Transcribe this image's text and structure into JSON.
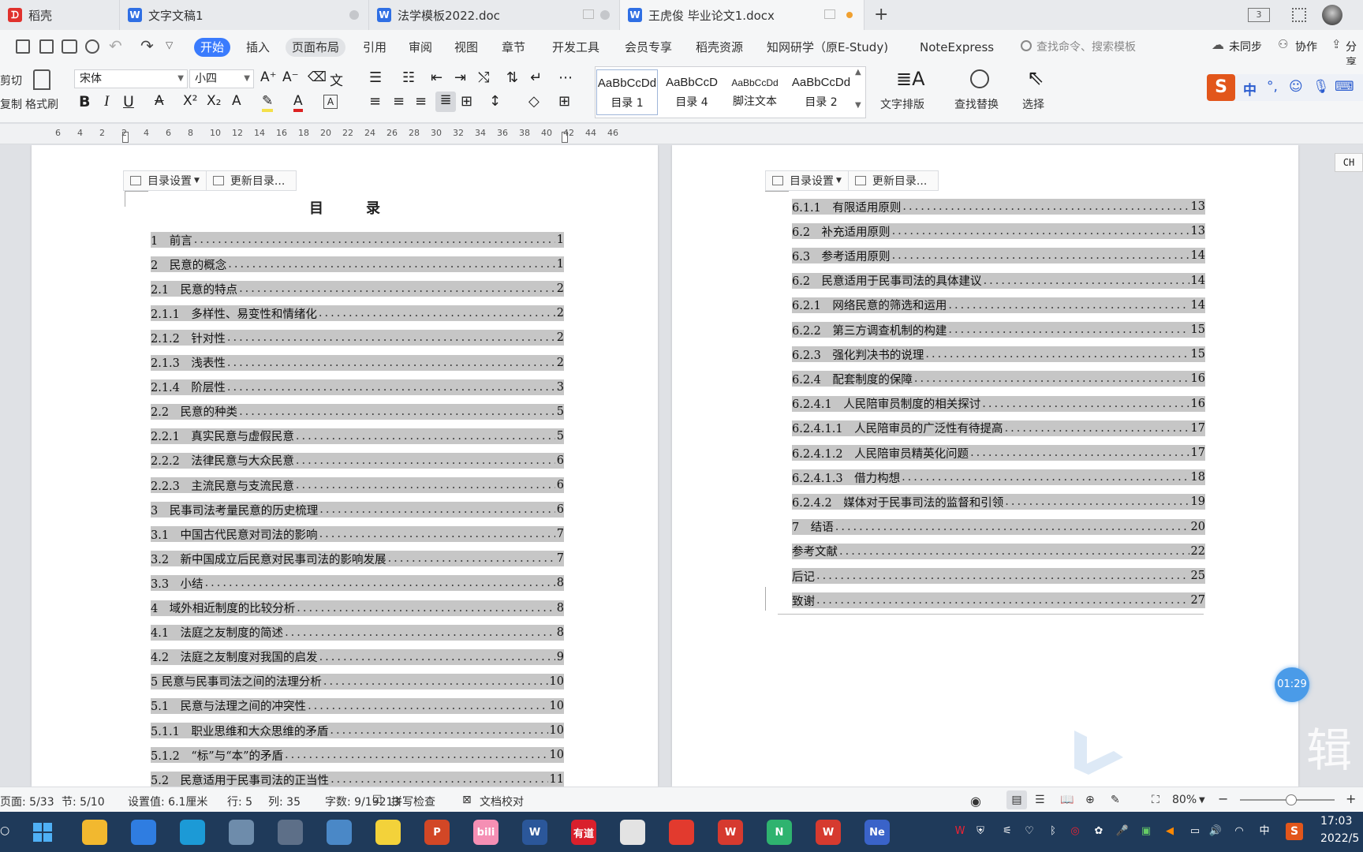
{
  "tabs": [
    {
      "label": "稻壳"
    },
    {
      "label": "文字文稿1"
    },
    {
      "label": "法学模板2022.doc"
    },
    {
      "label": "王虎俊 毕业论文1.docx"
    }
  ],
  "menu": {
    "items": [
      "开始",
      "插入",
      "页面布局",
      "引用",
      "审阅",
      "视图",
      "章节",
      "开发工具",
      "会员专享",
      "稻壳资源",
      "知网研学（原E-Study)",
      "NoteExpress"
    ],
    "search_placeholder": "查找命令、搜索模板",
    "unsynced": "未同步",
    "collab": "协作",
    "share": "分享"
  },
  "ribbon": {
    "cut": "剪切",
    "copy": "复制",
    "format_painter": "格式刷",
    "font": "宋体",
    "size": "小四",
    "styles": [
      {
        "preview": "AaBbCcDd",
        "name": "目录 1"
      },
      {
        "preview": "AaBbCcD",
        "name": "目录 4"
      },
      {
        "preview": "AaBbCcDd",
        "name": "脚注文本"
      },
      {
        "preview": "AaBbCcDd",
        "name": "目录 2"
      }
    ],
    "text_layout": "文字排版",
    "find_replace": "查找替换",
    "select": "选择",
    "ime_label": "中"
  },
  "ruler": {
    "ticks": [
      "6",
      "4",
      "2",
      "2",
      "4",
      "6",
      "8",
      "10",
      "12",
      "14",
      "16",
      "18",
      "20",
      "22",
      "24",
      "26",
      "28",
      "30",
      "32",
      "34",
      "36",
      "38",
      "40",
      "42",
      "44",
      "46"
    ]
  },
  "toc_toolbar": {
    "settings": "目录设置",
    "update": "更新目录..."
  },
  "page1": {
    "title": "目　　　录",
    "entries": [
      {
        "text": "1　前言",
        "page": "1"
      },
      {
        "text": "2　民意的概念",
        "page": "1"
      },
      {
        "text": "2.1　民意的特点",
        "page": "2"
      },
      {
        "text": "2.1.1　多样性、易变性和情绪化",
        "page": "2"
      },
      {
        "text": "2.1.2　针对性",
        "page": "2"
      },
      {
        "text": "2.1.3　浅表性",
        "page": "2"
      },
      {
        "text": "2.1.4　阶层性",
        "page": "3"
      },
      {
        "text": "2.2　民意的种类",
        "page": "5"
      },
      {
        "text": "2.2.1　真实民意与虚假民意",
        "page": "5"
      },
      {
        "text": "2.2.2　法律民意与大众民意",
        "page": "6"
      },
      {
        "text": "2.2.3　主流民意与支流民意",
        "page": "6"
      },
      {
        "text": "3　民事司法考量民意的历史梳理",
        "page": "6"
      },
      {
        "text": "3.1　中国古代民意对司法的影响",
        "page": "7"
      },
      {
        "text": "3.2　新中国成立后民意对民事司法的影响发展",
        "page": "7"
      },
      {
        "text": "3.3　小结",
        "page": "8"
      },
      {
        "text": "4　域外相近制度的比较分析",
        "page": "8"
      },
      {
        "text": "4.1　法庭之友制度的简述",
        "page": "8"
      },
      {
        "text": "4.2　法庭之友制度对我国的启发",
        "page": "9"
      },
      {
        "text": "5 民意与民事司法之间的法理分析",
        "page": "10"
      },
      {
        "text": "5.1　民意与法理之间的冲突性",
        "page": "10"
      },
      {
        "text": "5.1.1　职业思维和大众思维的矛盾",
        "page": "10"
      },
      {
        "text": "5.1.2　“标”与“本”的矛盾",
        "page": "10"
      },
      {
        "text": "5.2　民意适用于民事司法的正当性",
        "page": "11"
      }
    ]
  },
  "page2": {
    "entries": [
      {
        "text": "6.1.1　有限适用原则",
        "page": "13"
      },
      {
        "text": "6.2　补充适用原则",
        "page": "13"
      },
      {
        "text": "6.3　参考适用原则",
        "page": "14"
      },
      {
        "text": "6.2　民意适用于民事司法的具体建议",
        "page": "14"
      },
      {
        "text": "6.2.1　网络民意的筛选和运用",
        "page": "14"
      },
      {
        "text": "6.2.2　第三方调查机制的构建",
        "page": "15"
      },
      {
        "text": "6.2.3　强化判决书的说理",
        "page": "15"
      },
      {
        "text": "6.2.4　配套制度的保障",
        "page": "16"
      },
      {
        "text": "6.2.4.1　人民陪审员制度的相关探讨",
        "page": "16"
      },
      {
        "text": "6.2.4.1.1　人民陪审员的广泛性有待提高",
        "page": "17"
      },
      {
        "text": "6.2.4.1.2　人民陪审员精英化问题",
        "page": "17"
      },
      {
        "text": "6.2.4.1.3　借力构想",
        "page": "18"
      },
      {
        "text": "6.2.4.2　媒体对于民事司法的监督和引领",
        "page": "19"
      },
      {
        "text": "7　结语",
        "page": "20"
      },
      {
        "text": "参考文献",
        "page": "22"
      },
      {
        "text": "后记",
        "page": "25"
      },
      {
        "text": "致谢",
        "page": "27"
      }
    ]
  },
  "side_label": "CH",
  "timer": "01:29",
  "watermark_char": "辑",
  "status": {
    "page": "页面: 5/33",
    "section": "节: 5/10",
    "setting": "设置值: 6.1厘米",
    "row": "行: 5",
    "col": "列: 35",
    "words": "字数: 9/19213",
    "spell": "拼写检查",
    "proof": "文档校对",
    "zoom": "80%"
  },
  "taskbar": {
    "apps": [
      {
        "name": "file-explorer",
        "color": "#f2b82f",
        "label": ""
      },
      {
        "name": "mail",
        "color": "#2f7de1",
        "label": ""
      },
      {
        "name": "edge",
        "color": "#1c9ad6",
        "label": ""
      },
      {
        "name": "app-4",
        "color": "#6e8cab",
        "label": ""
      },
      {
        "name": "app-5",
        "color": "#5d6f88",
        "label": ""
      },
      {
        "name": "app-6",
        "color": "#4a88c7",
        "label": ""
      },
      {
        "name": "sticky-notes",
        "color": "#f3d23a",
        "label": ""
      },
      {
        "name": "powerpoint",
        "color": "#d24726",
        "label": "P"
      },
      {
        "name": "bilibili",
        "color": "#f58fb4",
        "label": "bili"
      },
      {
        "name": "word",
        "color": "#2b579a",
        "label": "W"
      },
      {
        "name": "youdao",
        "color": "#d9202c",
        "label": "有道"
      },
      {
        "name": "clock",
        "color": "#e3e3e3",
        "label": ""
      },
      {
        "name": "netease-music",
        "color": "#e23a2e",
        "label": ""
      },
      {
        "name": "wps-office",
        "color": "#d63a2f",
        "label": "W"
      },
      {
        "name": "app-15",
        "color": "#2fb36f",
        "label": "N"
      },
      {
        "name": "wps-writer",
        "color": "#d63a2f",
        "label": "W"
      },
      {
        "name": "noteexpress",
        "color": "#3a63c9",
        "label": "Ne"
      }
    ],
    "ime": "中",
    "time": "17:03",
    "date": "2022/5"
  }
}
